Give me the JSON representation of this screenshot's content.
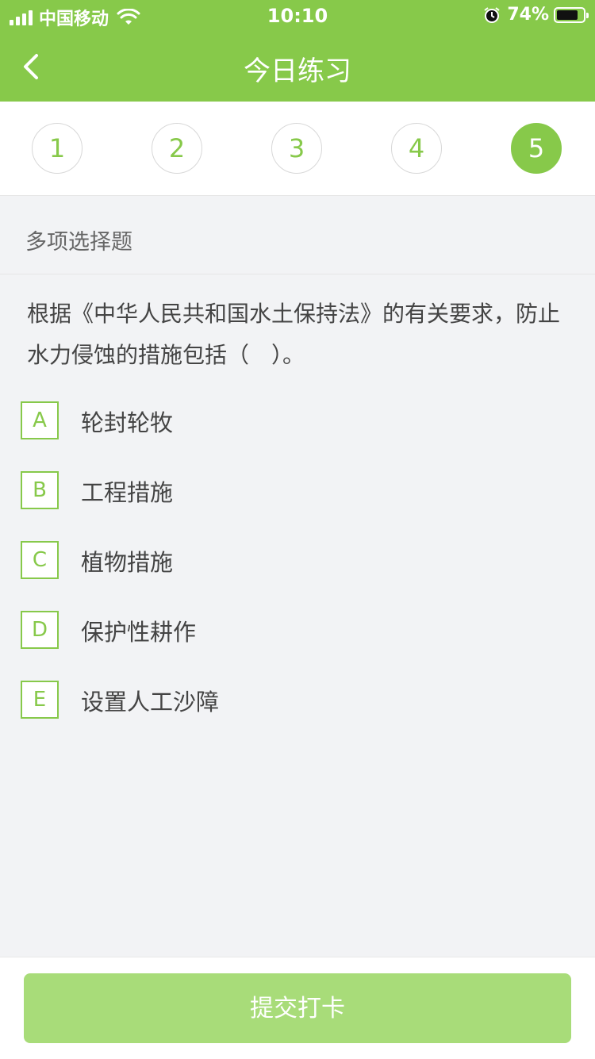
{
  "status_bar": {
    "carrier": "中国移动",
    "time": "10:10",
    "battery": "74%"
  },
  "header": {
    "title": "今日练习"
  },
  "steps": [
    "1",
    "2",
    "3",
    "4",
    "5"
  ],
  "current_step": "5",
  "question": {
    "type": "多项选择题",
    "text": "根据《中华人民共和国水土保持法》的有关要求，防止水力侵蚀的措施包括（　）。",
    "options": [
      {
        "letter": "A",
        "text": "轮封轮牧"
      },
      {
        "letter": "B",
        "text": "工程措施"
      },
      {
        "letter": "C",
        "text": "植物措施"
      },
      {
        "letter": "D",
        "text": "保护性耕作"
      },
      {
        "letter": "E",
        "text": "设置人工沙障"
      }
    ]
  },
  "footer": {
    "submit_label": "提交打卡"
  },
  "colors": {
    "brand": "#87c94a",
    "submit": "#a8dc79"
  }
}
